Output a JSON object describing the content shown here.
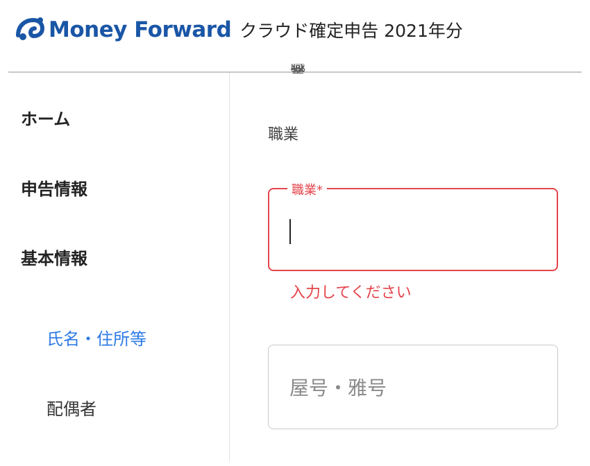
{
  "header": {
    "logo_text": "Money Forward",
    "app_title": "クラウド確定申告 2021年分",
    "brand_color": "#1a56a6",
    "logo_icon": "money-forward-logo-icon"
  },
  "sidebar": {
    "items": [
      {
        "label": "ホーム"
      },
      {
        "label": "申告情報"
      },
      {
        "label": "基本情報"
      }
    ],
    "sub_items": [
      {
        "label": "氏名・住所等",
        "active": true
      },
      {
        "label": "配偶者",
        "active": false
      }
    ],
    "active_color": "#2e7be6"
  },
  "main": {
    "cut_off_text": "職業",
    "section_label": "職業",
    "occupation_field": {
      "floating_label": "職業*",
      "value": "",
      "error_message": "入力してください",
      "error_color": "#e4444b"
    },
    "trade_name_field": {
      "placeholder": "屋号・雅号",
      "value": ""
    }
  }
}
